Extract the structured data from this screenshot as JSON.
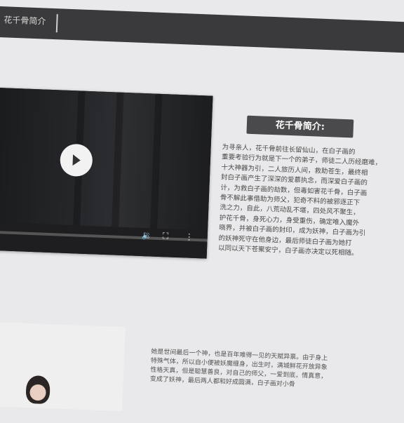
{
  "nav": {
    "title": "花千骨简介"
  },
  "intro": {
    "heading": "花千骨简介:",
    "text": "为寻亲人，花千骨前往长留仙山，在白子画的\n重要考验行为就是下一个的弟子，师徒二人历经磨难，\n十大神器为引，二人旅历人间，救助苍生，最终相\n封白子画产生了深深的爱慕执念，而深爱白子画的\n计，为救白子画的劫数，但毒如害花千骨，白子画\n骨不解此事借助为师父，犯奇不料的被邪逐正下\n洗之力，自此，八荒动乱不堪，四处风不聚生，\n护花千骨，身死心力，身受重伤，确定唯入魔外\n晓界，并被白子画的封印，成为妖神，白子画为引\n的妖神死守在他身边，最后师徒白子画为她打\n以同以天下苍聚安宁，白子画亦决定以死相随。"
  },
  "video": {
    "play_icon": "play-icon",
    "volume_icon": "volume-icon",
    "fullscreen_icon": "fullscreen-icon",
    "menu_icon": "more-icon",
    "progress": 0.0
  },
  "lower": {
    "text": "她是世间最后一个神，也是百年难得一见的天赋异禀。由于身上\n特殊气体，所以自小便被妖魔缠身，出生时，满城鲜花开放异象\n性格天真，但是聪慧善良，对自己的师父，一爱到底，情真意，\n变成了妖神，最后两人都和好成圆满，白子画对小骨"
  }
}
